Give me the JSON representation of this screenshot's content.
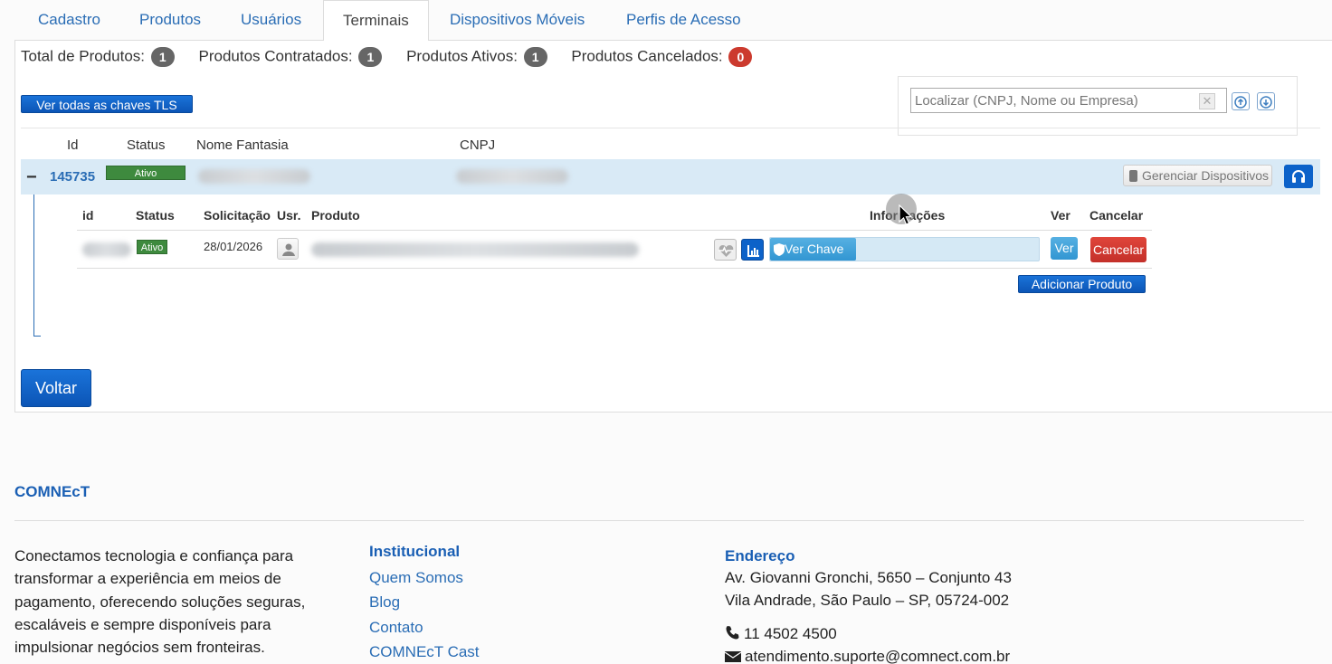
{
  "tabs": [
    {
      "label": "Cadastro"
    },
    {
      "label": "Produtos"
    },
    {
      "label": "Usuários"
    },
    {
      "label": "Terminais",
      "active": true
    },
    {
      "label": "Dispositivos Móveis"
    },
    {
      "label": "Perfis de Acesso"
    }
  ],
  "counters": [
    {
      "label": "Total de Produtos:",
      "value": "1"
    },
    {
      "label": "Produtos Contratados:",
      "value": "1"
    },
    {
      "label": "Produtos Ativos:",
      "value": "1"
    },
    {
      "label": "Produtos Cancelados:",
      "value": "0"
    }
  ],
  "tls_button": "Ver todas as chaves TLS",
  "search": {
    "placeholder": "Localizar (CNPJ, Nome ou Empresa)",
    "value": ""
  },
  "main_table": {
    "headers": {
      "id": "Id",
      "status": "Status",
      "nome": "Nome Fantasia",
      "cnpj": "CNPJ"
    },
    "row": {
      "toggle": "−",
      "id": "145735",
      "status": "Ativo",
      "gerenciar": "Gerenciar Dispositivos"
    }
  },
  "sub_table": {
    "headers": {
      "id": "id",
      "status": "Status",
      "solicitacao": "Solicitação",
      "usr": "Usr.",
      "produto": "Produto",
      "informacoes": "Informações",
      "ver": "Ver",
      "cancelar": "Cancelar"
    },
    "row": {
      "status": "Ativo",
      "solicitacao": "28/01/2026",
      "chave": "Ver Chave",
      "ver": "Ver",
      "cancelar": "Cancelar"
    },
    "add_button": "Adicionar Produto"
  },
  "back_button": "Voltar",
  "footer": {
    "brand": "COMNEcT",
    "about": "Conectamos tecnologia e confiança para transformar a experiência em meios de pagamento, oferecendo soluções seguras, escaláveis e sempre disponíveis para impulsionar negócios sem fronteiras.",
    "institucional_title": "Institucional",
    "links": [
      "Quem Somos",
      "Blog",
      "Contato",
      "COMNEcT Cast"
    ],
    "endereco_title": "Endereço",
    "address_line1": "Av. Giovanni Gronchi, 5650 – Conjunto 43",
    "address_line2": "Vila Andrade, São Paulo – SP, 05724-002",
    "phone": "11 4502 4500",
    "email": "atendimento.suporte@comnect.com.br"
  },
  "colors": {
    "primary": "#0c62c9",
    "link": "#2a6db5",
    "success": "#3e8a3e",
    "danger": "#cc3a2e",
    "row_highlight": "#d9eaf6"
  },
  "icons": [
    "phone-icon",
    "headset-icon",
    "person-icon",
    "heartbeat-icon",
    "chart-icon",
    "shield-icon",
    "upload-icon",
    "download-icon",
    "clear-icon",
    "envelope-icon"
  ]
}
